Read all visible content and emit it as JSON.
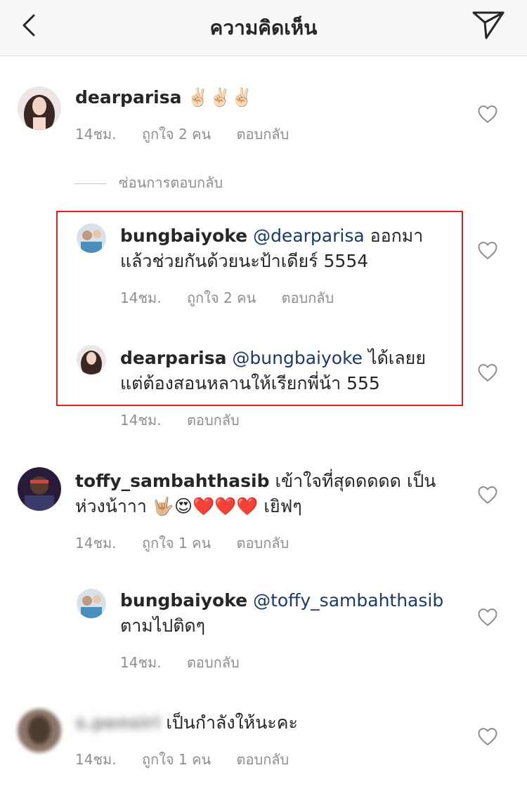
{
  "header": {
    "title": "ความคิดเห็น"
  },
  "hide_replies": "ซ่อนการตอบกลับ",
  "c1": {
    "user": "dearparisa",
    "body": "✌🏻✌🏻✌🏻",
    "time": "14ชม.",
    "likes": "ถูกใจ 2 คน",
    "reply": "ตอบกลับ"
  },
  "r1": {
    "user": "bungbaiyoke",
    "mention": "@dearparisa",
    "body_a": " ออกมา",
    "body_b": "แล้วช่วยกันด้วยนะป้าเดียร์ 5554",
    "time": "14ชม.",
    "likes": "ถูกใจ 2 คน",
    "reply": "ตอบกลับ"
  },
  "r2": {
    "user": "dearparisa",
    "mention": "@bungbaiyoke",
    "body_a": " ได้เลยย",
    "body_b": "แต่ต้องสอนหลานให้เรียกพี่น้า 555",
    "time": "14ชม.",
    "reply": "ตอบกลับ"
  },
  "c2": {
    "user": "toffy_sambahthasib",
    "body_a": " เข้าใจที่สุดดดดด เป็น",
    "body_b": "ห่วงน้าาา 🤟🏼😍❤️❤️❤️ เยิฟๆ",
    "time": "14ชม.",
    "likes": "ถูกใจ 1 คน",
    "reply": "ตอบกลับ"
  },
  "r3": {
    "user": "bungbaiyoke",
    "mention": "@toffy_sambahthasib",
    "body_b": "ตามไปติดๆ",
    "time": "14ชม.",
    "reply": "ตอบกลับ"
  },
  "c3": {
    "user": "s.pensiri",
    "body": " เป็นกำลังให้นะคะ",
    "time": "14ชม.",
    "likes": "ถูกใจ 1 คน",
    "reply": "ตอบกลับ"
  },
  "colors": {
    "mention": "#1b3a6b",
    "highlight": "#e0201f",
    "meta": "#8e8e8e"
  }
}
